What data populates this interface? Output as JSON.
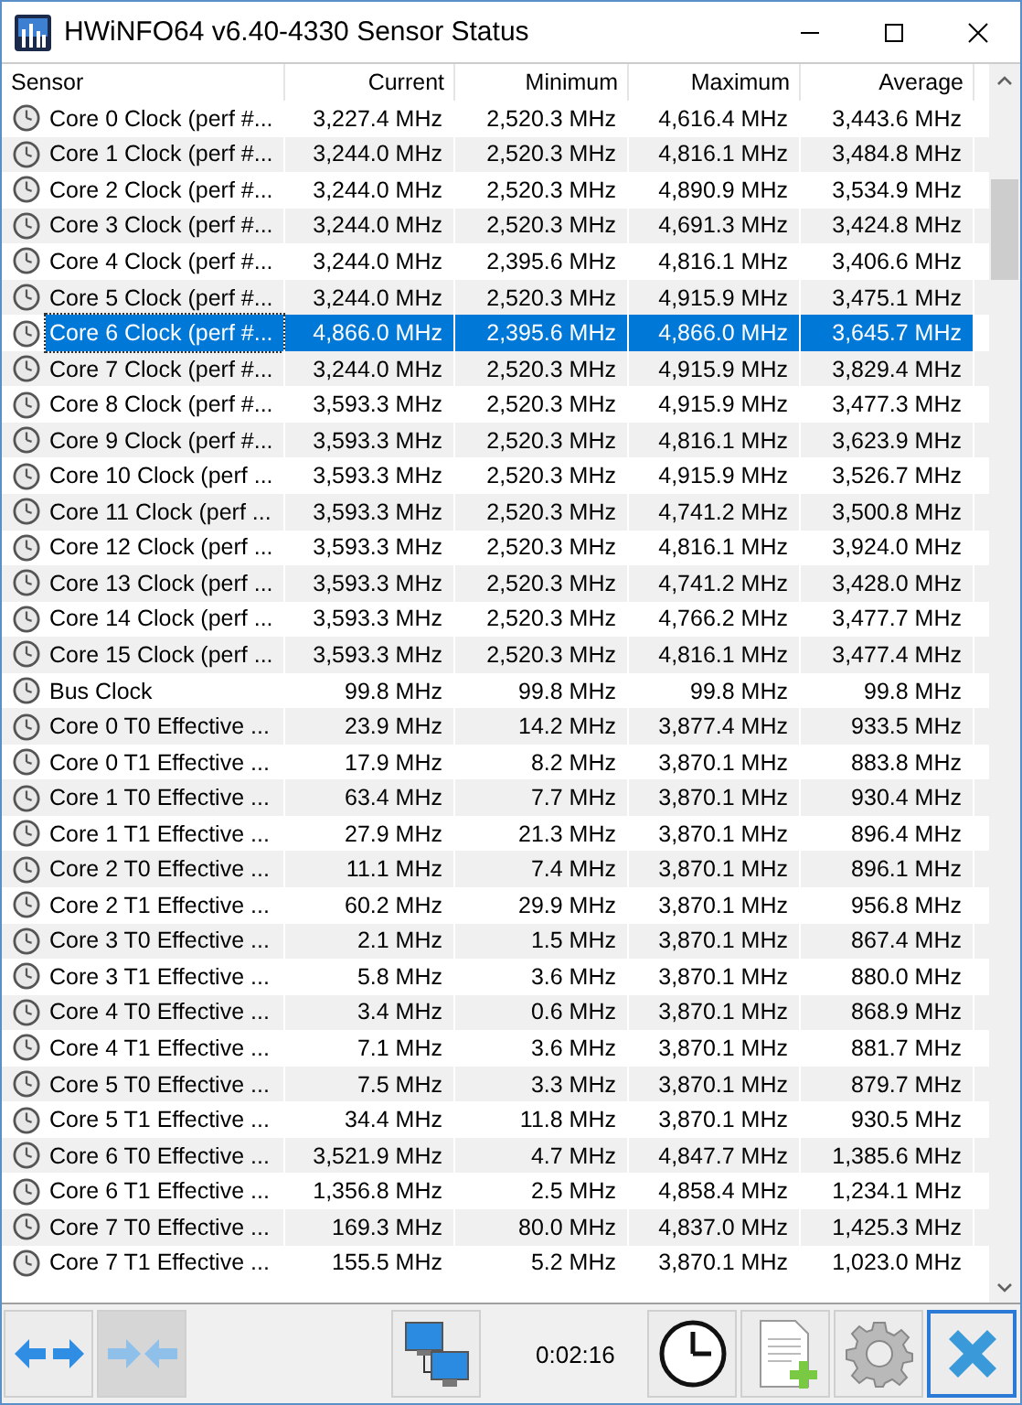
{
  "window": {
    "title": "HWiNFO64 v6.40-4330 Sensor Status"
  },
  "table": {
    "columns": [
      "Sensor",
      "Current",
      "Minimum",
      "Maximum",
      "Average"
    ],
    "rows": [
      {
        "sensor": "Core 0 Clock (perf #...",
        "current": "3,227.4 MHz",
        "minimum": "2,520.3 MHz",
        "maximum": "4,616.4 MHz",
        "average": "3,443.6 MHz",
        "selected": false
      },
      {
        "sensor": "Core 1 Clock (perf #...",
        "current": "3,244.0 MHz",
        "minimum": "2,520.3 MHz",
        "maximum": "4,816.1 MHz",
        "average": "3,484.8 MHz",
        "selected": false
      },
      {
        "sensor": "Core 2 Clock (perf #...",
        "current": "3,244.0 MHz",
        "minimum": "2,520.3 MHz",
        "maximum": "4,890.9 MHz",
        "average": "3,534.9 MHz",
        "selected": false
      },
      {
        "sensor": "Core 3 Clock (perf #...",
        "current": "3,244.0 MHz",
        "minimum": "2,520.3 MHz",
        "maximum": "4,691.3 MHz",
        "average": "3,424.8 MHz",
        "selected": false
      },
      {
        "sensor": "Core 4 Clock (perf #...",
        "current": "3,244.0 MHz",
        "minimum": "2,395.6 MHz",
        "maximum": "4,816.1 MHz",
        "average": "3,406.6 MHz",
        "selected": false
      },
      {
        "sensor": "Core 5 Clock (perf #...",
        "current": "3,244.0 MHz",
        "minimum": "2,520.3 MHz",
        "maximum": "4,915.9 MHz",
        "average": "3,475.1 MHz",
        "selected": false
      },
      {
        "sensor": "Core 6 Clock (perf #...",
        "current": "4,866.0 MHz",
        "minimum": "2,395.6 MHz",
        "maximum": "4,866.0 MHz",
        "average": "3,645.7 MHz",
        "selected": true
      },
      {
        "sensor": "Core 7 Clock (perf #...",
        "current": "3,244.0 MHz",
        "minimum": "2,520.3 MHz",
        "maximum": "4,915.9 MHz",
        "average": "3,829.4 MHz",
        "selected": false
      },
      {
        "sensor": "Core 8 Clock (perf #...",
        "current": "3,593.3 MHz",
        "minimum": "2,520.3 MHz",
        "maximum": "4,915.9 MHz",
        "average": "3,477.3 MHz",
        "selected": false
      },
      {
        "sensor": "Core 9 Clock (perf #...",
        "current": "3,593.3 MHz",
        "minimum": "2,520.3 MHz",
        "maximum": "4,816.1 MHz",
        "average": "3,623.9 MHz",
        "selected": false
      },
      {
        "sensor": "Core 10 Clock (perf ...",
        "current": "3,593.3 MHz",
        "minimum": "2,520.3 MHz",
        "maximum": "4,915.9 MHz",
        "average": "3,526.7 MHz",
        "selected": false
      },
      {
        "sensor": "Core 11 Clock (perf ...",
        "current": "3,593.3 MHz",
        "minimum": "2,520.3 MHz",
        "maximum": "4,741.2 MHz",
        "average": "3,500.8 MHz",
        "selected": false
      },
      {
        "sensor": "Core 12 Clock (perf ...",
        "current": "3,593.3 MHz",
        "minimum": "2,520.3 MHz",
        "maximum": "4,816.1 MHz",
        "average": "3,924.0 MHz",
        "selected": false
      },
      {
        "sensor": "Core 13 Clock (perf ...",
        "current": "3,593.3 MHz",
        "minimum": "2,520.3 MHz",
        "maximum": "4,741.2 MHz",
        "average": "3,428.0 MHz",
        "selected": false
      },
      {
        "sensor": "Core 14 Clock (perf ...",
        "current": "3,593.3 MHz",
        "minimum": "2,520.3 MHz",
        "maximum": "4,766.2 MHz",
        "average": "3,477.7 MHz",
        "selected": false
      },
      {
        "sensor": "Core 15 Clock (perf ...",
        "current": "3,593.3 MHz",
        "minimum": "2,520.3 MHz",
        "maximum": "4,816.1 MHz",
        "average": "3,477.4 MHz",
        "selected": false
      },
      {
        "sensor": "Bus Clock",
        "current": "99.8 MHz",
        "minimum": "99.8 MHz",
        "maximum": "99.8 MHz",
        "average": "99.8 MHz",
        "selected": false
      },
      {
        "sensor": "Core 0 T0 Effective ...",
        "current": "23.9 MHz",
        "minimum": "14.2 MHz",
        "maximum": "3,877.4 MHz",
        "average": "933.5 MHz",
        "selected": false
      },
      {
        "sensor": "Core 0 T1 Effective ...",
        "current": "17.9 MHz",
        "minimum": "8.2 MHz",
        "maximum": "3,870.1 MHz",
        "average": "883.8 MHz",
        "selected": false
      },
      {
        "sensor": "Core 1 T0 Effective ...",
        "current": "63.4 MHz",
        "minimum": "7.7 MHz",
        "maximum": "3,870.1 MHz",
        "average": "930.4 MHz",
        "selected": false
      },
      {
        "sensor": "Core 1 T1 Effective ...",
        "current": "27.9 MHz",
        "minimum": "21.3 MHz",
        "maximum": "3,870.1 MHz",
        "average": "896.4 MHz",
        "selected": false
      },
      {
        "sensor": "Core 2 T0 Effective ...",
        "current": "11.1 MHz",
        "minimum": "7.4 MHz",
        "maximum": "3,870.1 MHz",
        "average": "896.1 MHz",
        "selected": false
      },
      {
        "sensor": "Core 2 T1 Effective ...",
        "current": "60.2 MHz",
        "minimum": "29.9 MHz",
        "maximum": "3,870.1 MHz",
        "average": "956.8 MHz",
        "selected": false
      },
      {
        "sensor": "Core 3 T0 Effective ...",
        "current": "2.1 MHz",
        "minimum": "1.5 MHz",
        "maximum": "3,870.1 MHz",
        "average": "867.4 MHz",
        "selected": false
      },
      {
        "sensor": "Core 3 T1 Effective ...",
        "current": "5.8 MHz",
        "minimum": "3.6 MHz",
        "maximum": "3,870.1 MHz",
        "average": "880.0 MHz",
        "selected": false
      },
      {
        "sensor": "Core 4 T0 Effective ...",
        "current": "3.4 MHz",
        "minimum": "0.6 MHz",
        "maximum": "3,870.1 MHz",
        "average": "868.9 MHz",
        "selected": false
      },
      {
        "sensor": "Core 4 T1 Effective ...",
        "current": "7.1 MHz",
        "minimum": "3.6 MHz",
        "maximum": "3,870.1 MHz",
        "average": "881.7 MHz",
        "selected": false
      },
      {
        "sensor": "Core 5 T0 Effective ...",
        "current": "7.5 MHz",
        "minimum": "3.3 MHz",
        "maximum": "3,870.1 MHz",
        "average": "879.7 MHz",
        "selected": false
      },
      {
        "sensor": "Core 5 T1 Effective ...",
        "current": "34.4 MHz",
        "minimum": "11.8 MHz",
        "maximum": "3,870.1 MHz",
        "average": "930.5 MHz",
        "selected": false
      },
      {
        "sensor": "Core 6 T0 Effective ...",
        "current": "3,521.9 MHz",
        "minimum": "4.7 MHz",
        "maximum": "4,847.7 MHz",
        "average": "1,385.6 MHz",
        "selected": false
      },
      {
        "sensor": "Core 6 T1 Effective ...",
        "current": "1,356.8 MHz",
        "minimum": "2.5 MHz",
        "maximum": "4,858.4 MHz",
        "average": "1,234.1 MHz",
        "selected": false
      },
      {
        "sensor": "Core 7 T0 Effective ...",
        "current": "169.3 MHz",
        "minimum": "80.0 MHz",
        "maximum": "4,837.0 MHz",
        "average": "1,425.3 MHz",
        "selected": false
      },
      {
        "sensor": "Core 7 T1 Effective ...",
        "current": "155.5 MHz",
        "minimum": "5.2 MHz",
        "maximum": "3,870.1 MHz",
        "average": "1,023.0 MHz",
        "selected": false
      }
    ]
  },
  "toolbar": {
    "timer": "0:02:16",
    "buttons": [
      {
        "kind": "expand",
        "pressed": false,
        "focused": false
      },
      {
        "kind": "collapse",
        "pressed": true,
        "focused": false
      },
      {
        "kind": "network",
        "pressed": false,
        "focused": false
      },
      {
        "kind": "timer",
        "pressed": false,
        "focused": false
      },
      {
        "kind": "report",
        "pressed": false,
        "focused": false
      },
      {
        "kind": "settings",
        "pressed": false,
        "focused": false
      },
      {
        "kind": "close",
        "pressed": false,
        "focused": true
      }
    ]
  }
}
